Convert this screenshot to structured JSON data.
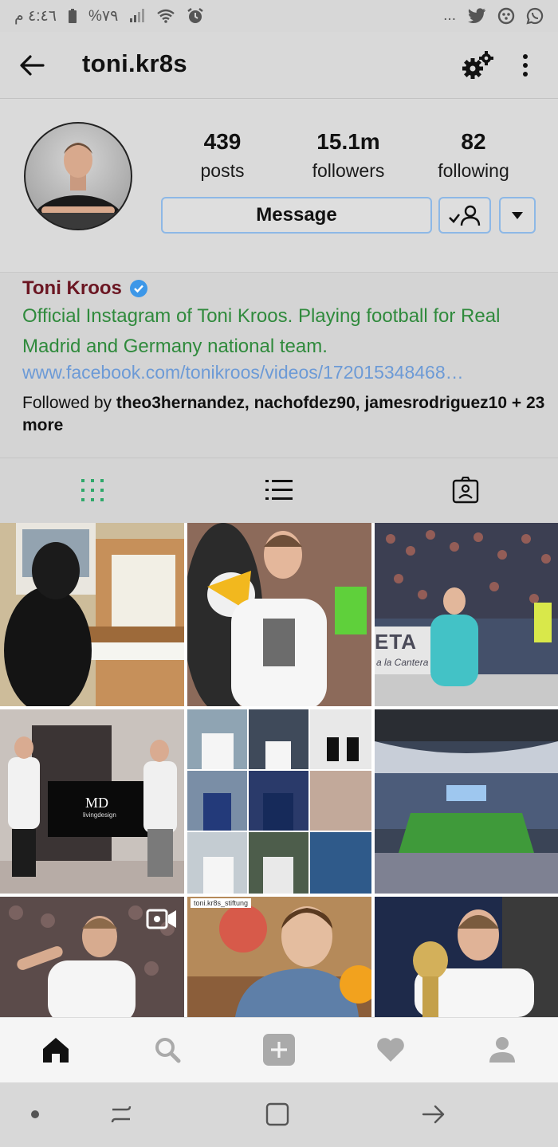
{
  "status_bar": {
    "time": "٤:٤٦ م",
    "battery": "%٧٩",
    "left_icons": [
      "clock-icon",
      "wifi-icon",
      "signal-icon",
      "battery-icon"
    ],
    "right_icons": [
      "more-notifications-icon",
      "twitter-icon",
      "game-icon",
      "whatsapp-icon"
    ],
    "more_text": "..."
  },
  "header": {
    "username": "toni.kr8s"
  },
  "profile": {
    "stats": [
      {
        "value": "439",
        "label": "posts"
      },
      {
        "value": "15.1m",
        "label": "followers"
      },
      {
        "value": "82",
        "label": "following"
      }
    ],
    "message_label": "Message"
  },
  "bio": {
    "full_name": "Toni Kroos",
    "text": "Official Instagram of Toni Kroos. Playing football for Real Madrid and Germany national team.",
    "link": "www.facebook.com/tonikroos/videos/172015348468…",
    "followed_prefix": "Followed by ",
    "followed_names": "theo3hernandez, nachofdez90, jamesrodriguez10",
    "followed_suffix": " + 23 more"
  },
  "tabs": [
    "grid-view-icon",
    "list-view-icon",
    "tagged-icon"
  ],
  "posts": [
    {
      "desc": "piano"
    },
    {
      "desc": "mascot"
    },
    {
      "desc": "stadium-crowd",
      "caption": "ETA",
      "caption2": "a la Cantera"
    },
    {
      "desc": "md-livingdesign",
      "logo_main": "MD",
      "logo_sub": "livingdesign"
    },
    {
      "desc": "collage"
    },
    {
      "desc": "stadium"
    },
    {
      "desc": "video-post"
    },
    {
      "desc": "tagged-child",
      "tag": "toni.kr8s_stiftung"
    },
    {
      "desc": "trophy"
    }
  ],
  "bottom_nav": [
    "home-icon",
    "search-icon",
    "add-post-icon",
    "activity-heart-icon",
    "profile-icon"
  ],
  "colors": {
    "full_name": "#6b1622",
    "bio_text": "#2f8a3c",
    "link": "#6c9ad6",
    "button_border": "#8db8e6",
    "grid_tab_active": "#2fa86a"
  }
}
